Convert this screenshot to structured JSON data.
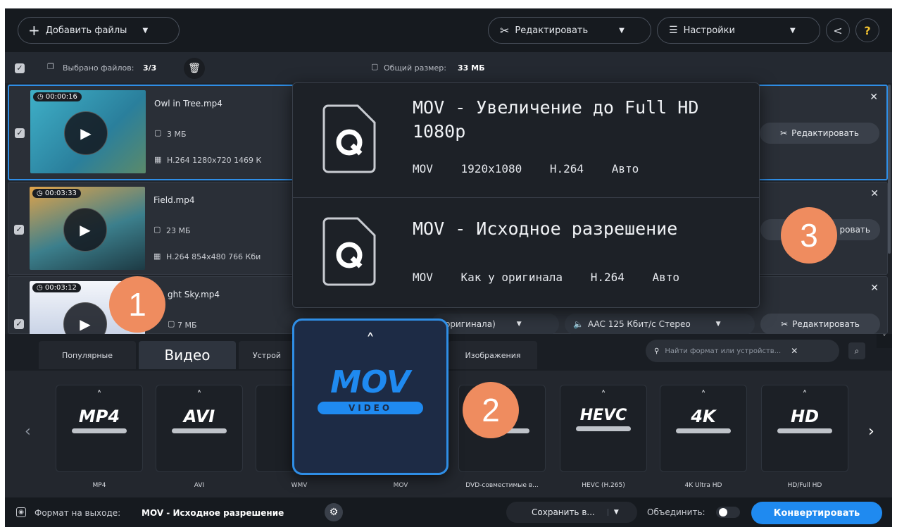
{
  "toolbar": {
    "add_files": "Добавить файлы",
    "edit": "Редактировать",
    "settings": "Настройки",
    "help": "?"
  },
  "selection": {
    "selected_label": "Выбрано файлов:",
    "selected_value": "3/3",
    "total_label": "Общий размер:",
    "total_value": "33 МБ"
  },
  "files": [
    {
      "name": "Owl in Tree.mp4",
      "duration": "00:00:16",
      "size": "3 МБ",
      "codec": "H.264 1280x720 1469 К",
      "edit": "Редактировать"
    },
    {
      "name": "Field.mp4",
      "duration": "00:03:33",
      "size": "23 МБ",
      "codec": "H.264 854x480 766 Кби",
      "edit": "ровать"
    },
    {
      "name": "ght Sky.mp4",
      "duration": "00:03:12",
      "size": "7 МБ",
      "video_setting": "оригинала)",
      "audio": "AAC 125 Кбит/с Стерео",
      "edit": "Редактировать"
    }
  ],
  "popup": {
    "items": [
      {
        "title": "MOV - Увеличение до Full HD 1080p",
        "specs": [
          "MOV",
          "1920x1080",
          "H.264",
          "Авто"
        ]
      },
      {
        "title": "MOV - Исходное разрешение",
        "specs": [
          "MOV",
          "Как у оригинала",
          "H.264",
          "Авто"
        ]
      }
    ]
  },
  "tabs": {
    "popular": "Популярные",
    "video": "Видео",
    "devices": "Устрой",
    "images": "Изображения"
  },
  "search": {
    "placeholder": "Найти формат или устройств..."
  },
  "formats": [
    {
      "logo": "MP4",
      "label": "MP4"
    },
    {
      "logo": "AVI",
      "label": "AVI"
    },
    {
      "logo": "",
      "label": "WMV"
    },
    {
      "logo": "MOV",
      "label": "MOV"
    },
    {
      "logo": "D",
      "label": "DVD-совместимые в..."
    },
    {
      "logo": "HEVC",
      "label": "HEVC (H.265)"
    },
    {
      "logo": "4K",
      "label": "4K Ultra HD"
    },
    {
      "logo": "HD",
      "label": "HD/Full HD"
    }
  ],
  "big_mov": {
    "logo": "MOV",
    "sub": "VIDEO"
  },
  "bottom": {
    "output_label": "Формат на выходе:",
    "output_value": "MOV - Исходное разрешение",
    "save_to": "Сохранить в...",
    "merge": "Объединить:",
    "convert": "Конвертировать"
  },
  "badges": [
    "1",
    "2",
    "3"
  ],
  "colors": {
    "accent": "#1f8af0",
    "badge": "#ef8c5f",
    "bg": "#1f2329"
  }
}
